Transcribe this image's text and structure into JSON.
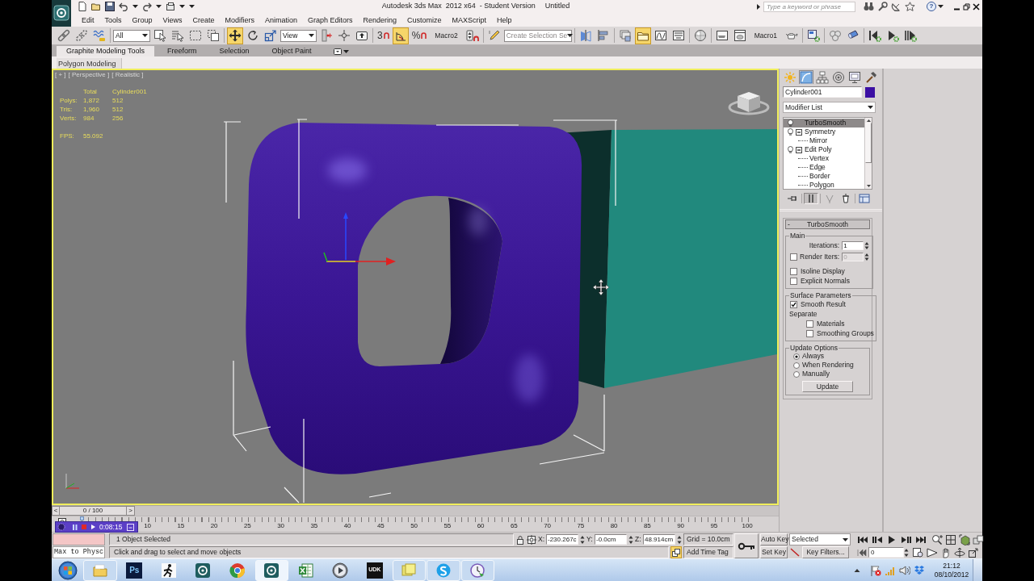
{
  "title_bar": {
    "title": "Autodesk 3ds Max  2012 x64  - Student Version",
    "document": "Untitled",
    "search": {
      "placeholder": "Type a keyword or phrase"
    },
    "help": "?"
  },
  "menu": [
    "Edit",
    "Tools",
    "Group",
    "Views",
    "Create",
    "Modifiers",
    "Animation",
    "Graph Editors",
    "Rendering",
    "Customize",
    "MAXScript",
    "Help"
  ],
  "main_toolbar": [
    {
      "kind": "button",
      "selected": false
    },
    {
      "kind": "button",
      "selected": false
    },
    {
      "kind": "button",
      "selected": false
    },
    {
      "kind": "separator"
    },
    {
      "kind": "dropdown",
      "value": "All"
    },
    {
      "kind": "button",
      "selected": false
    },
    {
      "kind": "button",
      "selected": false
    },
    {
      "kind": "button",
      "selected": false
    },
    {
      "kind": "button",
      "selected": false
    },
    {
      "kind": "separator"
    },
    {
      "kind": "button",
      "selected": true
    },
    {
      "kind": "button",
      "selected": false
    },
    {
      "kind": "button",
      "selected": false
    },
    {
      "kind": "dropdown",
      "value": "View"
    },
    {
      "kind": "button",
      "selected": false
    },
    {
      "kind": "button",
      "selected": false
    },
    {
      "kind": "button",
      "selected": false
    },
    {
      "kind": "separator"
    },
    {
      "kind": "snap",
      "glyph": "3",
      "selected": false
    },
    {
      "kind": "button",
      "selected": true
    },
    {
      "kind": "snap",
      "glyph": "%",
      "selected": false
    },
    {
      "kind": "macro",
      "label": "Macro2"
    },
    {
      "kind": "button",
      "selected": false
    },
    {
      "kind": "separator"
    },
    {
      "kind": "button",
      "selected": false
    },
    {
      "kind": "dropdown",
      "placeholder": "Create Selection Se"
    },
    {
      "kind": "separator"
    },
    {
      "kind": "button",
      "selected": false
    },
    {
      "kind": "button",
      "selected": false
    },
    {
      "kind": "separator"
    },
    {
      "kind": "button",
      "selected": false
    },
    {
      "kind": "button",
      "selected": true
    },
    {
      "kind": "button",
      "selected": false
    },
    {
      "kind": "button",
      "selected": false
    },
    {
      "kind": "separator"
    },
    {
      "kind": "button",
      "selected": false
    },
    {
      "kind": "separator"
    },
    {
      "kind": "button",
      "selected": false
    },
    {
      "kind": "button",
      "selected": false
    },
    {
      "kind": "macro",
      "label": "Macro1"
    },
    {
      "kind": "button",
      "selected": false
    },
    {
      "kind": "separator"
    },
    {
      "kind": "button",
      "selected": false
    },
    {
      "kind": "separator"
    },
    {
      "kind": "button",
      "selected": false
    },
    {
      "kind": "button",
      "selected": false
    },
    {
      "kind": "separator"
    },
    {
      "kind": "button",
      "selected": false
    },
    {
      "kind": "button",
      "selected": false
    },
    {
      "kind": "button",
      "selected": false
    }
  ],
  "ribbon": {
    "tabs": [
      {
        "label": "Graphite Modeling Tools",
        "selected": true
      },
      {
        "label": "Freeform",
        "selected": false
      },
      {
        "label": "Selection",
        "selected": false
      },
      {
        "label": "Object Paint",
        "selected": false
      }
    ],
    "panel": "Polygon Modeling"
  },
  "viewport": {
    "labels": [
      "[ + ]",
      "[ Perspective ]",
      "[ Realistic ]"
    ],
    "statistics": {
      "columns": [
        "Total",
        "Cylinder001"
      ],
      "rows": [
        {
          "label": "Polys:",
          "values": [
            "1,872",
            "512"
          ]
        },
        {
          "label": "Tris:",
          "values": [
            "1,960",
            "512"
          ]
        },
        {
          "label": "Verts:",
          "values": [
            "984",
            "256"
          ]
        }
      ],
      "fps": {
        "label": "FPS:",
        "value": "55.092"
      }
    }
  },
  "command_panel": {
    "tabs": [
      {
        "selected": false
      },
      {
        "selected": true
      },
      {
        "selected": false
      },
      {
        "selected": false
      },
      {
        "selected": false
      },
      {
        "selected": false
      }
    ],
    "object_name": {
      "value": "Cylinder001",
      "color": "#3b0fa3"
    },
    "modifier_list": "Modifier List",
    "stack": [
      {
        "label": "TurboSmooth",
        "selected": true
      },
      {
        "label": "Symmetry",
        "selected": false,
        "expanded": true,
        "children": [
          {
            "label": "Mirror",
            "selected": false
          }
        ]
      },
      {
        "label": "Edit Poly",
        "selected": false,
        "expanded": true,
        "children": [
          {
            "label": "Vertex",
            "selected": false
          },
          {
            "label": "Edge",
            "selected": false
          },
          {
            "label": "Border",
            "selected": false
          },
          {
            "label": "Polygon",
            "selected": false
          }
        ]
      }
    ],
    "stack_tools": [
      {
        "selected": false,
        "disabled": false
      },
      {
        "selected": true,
        "disabled": false
      },
      {
        "selected": false,
        "disabled": true
      },
      {
        "selected": false,
        "disabled": false
      },
      {
        "selected": false,
        "disabled": false
      }
    ],
    "rollout": {
      "sign": "-",
      "title": "TurboSmooth",
      "groups": [
        {
          "title": "Main",
          "rows": [
            {
              "kind": "spinner",
              "label": "Iterations:",
              "value": "1",
              "disabled": false
            },
            {
              "kind": "check_spinner",
              "label": "Render Iters:",
              "checked": false,
              "value": "0",
              "disabled": true
            },
            {
              "kind": "checkbox",
              "label": "Isoline Display",
              "checked": false
            },
            {
              "kind": "checkbox",
              "label": "Explicit Normals",
              "checked": false
            }
          ]
        },
        {
          "title": "Surface Parameters",
          "rows": [
            {
              "kind": "checkbox",
              "label": "Smooth Result",
              "checked": true
            },
            {
              "kind": "heading",
              "label": "Separate",
              "children": [
                {
                  "kind": "checkbox",
                  "label": "Materials",
                  "checked": false
                },
                {
                  "kind": "checkbox",
                  "label": "Smoothing Groups",
                  "checked": false
                }
              ]
            }
          ]
        },
        {
          "title": "Update Options",
          "rows": [
            {
              "kind": "radio",
              "label": "Always",
              "selected": true
            },
            {
              "kind": "radio",
              "label": "When Rendering",
              "selected": false
            },
            {
              "kind": "radio",
              "label": "Manually",
              "selected": false
            },
            {
              "kind": "button",
              "label": "Update"
            }
          ]
        }
      ]
    }
  },
  "timeline": {
    "slider": {
      "prev": "<",
      "label": "0 / 100",
      "next": ">",
      "level": 0
    },
    "ticks": [
      "10",
      "15",
      "20",
      "25",
      "30",
      "35",
      "40",
      "45",
      "50",
      "55",
      "60",
      "65",
      "70",
      "75",
      "80",
      "85",
      "90",
      "95",
      "100"
    ]
  },
  "recorder": {
    "time": "0:08:15"
  },
  "status": {
    "listener": "Max to Physc",
    "selection": "1 Object Selected",
    "prompt": "Click and drag to select and move objects",
    "coordinates": [
      {
        "axis": "X:",
        "value": "-230.267c"
      },
      {
        "axis": "Y:",
        "value": "-0.0cm"
      },
      {
        "axis": "Z:",
        "value": "48.914cm"
      }
    ],
    "grid": "Grid = 10.0cm",
    "degradation": {
      "on": true
    },
    "time_tag": "Add Time Tag",
    "auto_key": "Auto Key",
    "set_key": "Set Key",
    "key_set": "Selected",
    "key_filters": "Key Filters...",
    "frame": "0"
  },
  "taskbar": {
    "apps": [
      {
        "running": true,
        "selected": false
      },
      {
        "glyph": "Ps",
        "running": false,
        "selected": false
      },
      {
        "running": false,
        "selected": false
      },
      {
        "running": false,
        "selected": false
      },
      {
        "running": false,
        "selected": false
      },
      {
        "running": true,
        "selected": true
      },
      {
        "running": false,
        "selected": false
      },
      {
        "running": false,
        "selected": false
      },
      {
        "glyph": "UDK",
        "running": false,
        "selected": false
      },
      {
        "running": true,
        "selected": false
      },
      {
        "running": true,
        "selected": false
      },
      {
        "running": true,
        "selected": false
      }
    ],
    "clock": {
      "time": "21:12",
      "date": "08/10/2012"
    }
  }
}
